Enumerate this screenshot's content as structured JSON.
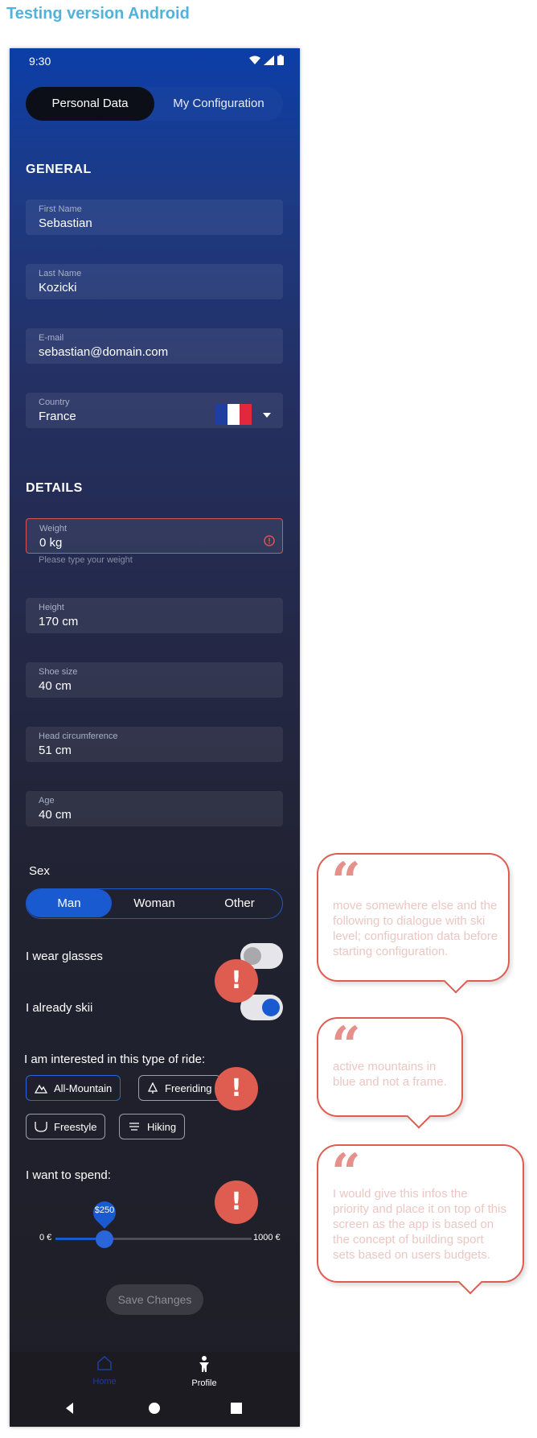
{
  "page_title": "Testing version Android",
  "status_bar": {
    "time": "9:30"
  },
  "top_tabs": {
    "active": "Personal Data",
    "inactive": "My Configuration"
  },
  "general": {
    "title": "GENERAL",
    "first_name": {
      "label": "First Name",
      "value": "Sebastian"
    },
    "last_name": {
      "label": "Last Name",
      "value": "Kozicki"
    },
    "email": {
      "label": "E-mail",
      "value": "sebastian@domain.com"
    },
    "country": {
      "label": "Country",
      "value": "France"
    }
  },
  "details": {
    "title": "DETAILS",
    "weight": {
      "label": "Weight",
      "value": "0 kg",
      "helper": "Please type your weight"
    },
    "height": {
      "label": "Height",
      "value": "170 cm"
    },
    "shoe_size": {
      "label": "Shoe size",
      "value": "40 cm"
    },
    "head": {
      "label": "Head circumference",
      "value": "51 cm"
    },
    "age": {
      "label": "Age",
      "value": "40 cm"
    }
  },
  "sex": {
    "label": "Sex",
    "options": [
      "Man",
      "Woman",
      "Other"
    ],
    "selected": "Man"
  },
  "toggles": {
    "glasses": {
      "label": "I wear glasses",
      "on": false
    },
    "ski": {
      "label": "I already skii",
      "on": true
    }
  },
  "ride": {
    "label": "I am interested in this type of ride:",
    "chips": [
      "All-Mountain",
      "Freeriding",
      "Freestyle",
      "Hiking"
    ],
    "selected": "All-Mountain"
  },
  "spend": {
    "label": "I want to spend:",
    "min": "0 €",
    "max": "1000 €",
    "value_label": "$250",
    "value": 250,
    "range": [
      0,
      1000
    ]
  },
  "save_button": "Save Changes",
  "bottom_nav": {
    "home": "Home",
    "profile": "Profile"
  },
  "comments": [
    "move somewhere else and the following to dialogue with ski level; configuration data before starting configuration.",
    "active mountains in blue and not a frame.",
    "I would give this infos the priority and place it on top of this screen as the app is based on the concept of building sport sets based on users budgets."
  ],
  "colors": {
    "accent": "#1a5ad0",
    "warning": "#df5c50",
    "heading": "#4fb3dd",
    "error": "#d9534f"
  }
}
